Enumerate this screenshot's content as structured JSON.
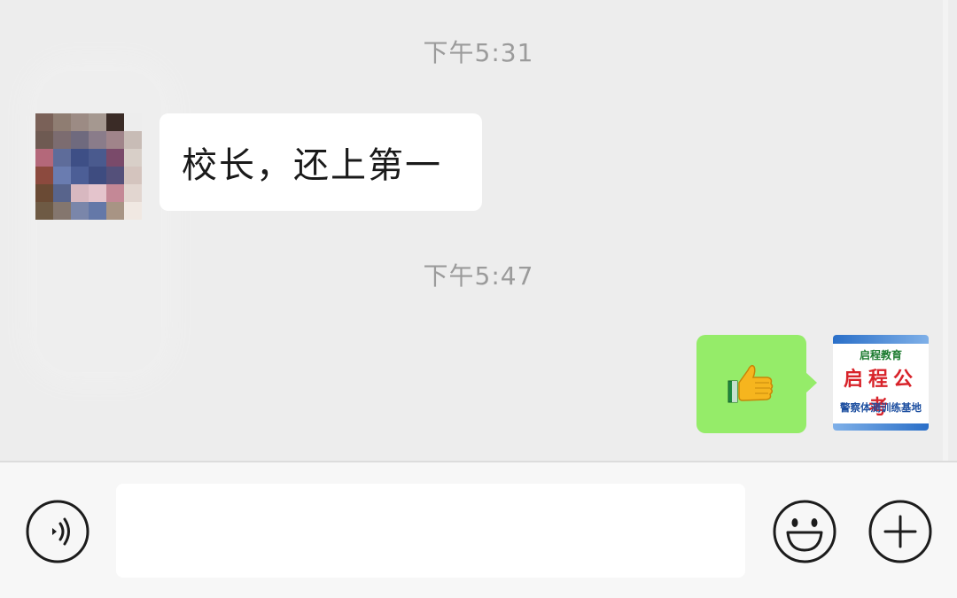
{
  "chat": {
    "timestamps": [
      "下午5:31",
      "下午5:47"
    ],
    "messages": [
      {
        "side": "left",
        "text": "校长，还上第一"
      },
      {
        "side": "right",
        "content": "thumbs-up emoji"
      }
    ]
  },
  "avatar_right": {
    "line1": "启程教育",
    "line2": "启程公考",
    "line3": "警察体测训练基地"
  },
  "input_bar": {
    "placeholder": "",
    "value": "",
    "icons": [
      "voice-icon",
      "emoji-icon",
      "plus-icon"
    ]
  },
  "colors": {
    "background": "#ededed",
    "bubble_incoming": "#ffffff",
    "bubble_outgoing": "#95ec69",
    "timestamp": "#9b9b9b"
  }
}
